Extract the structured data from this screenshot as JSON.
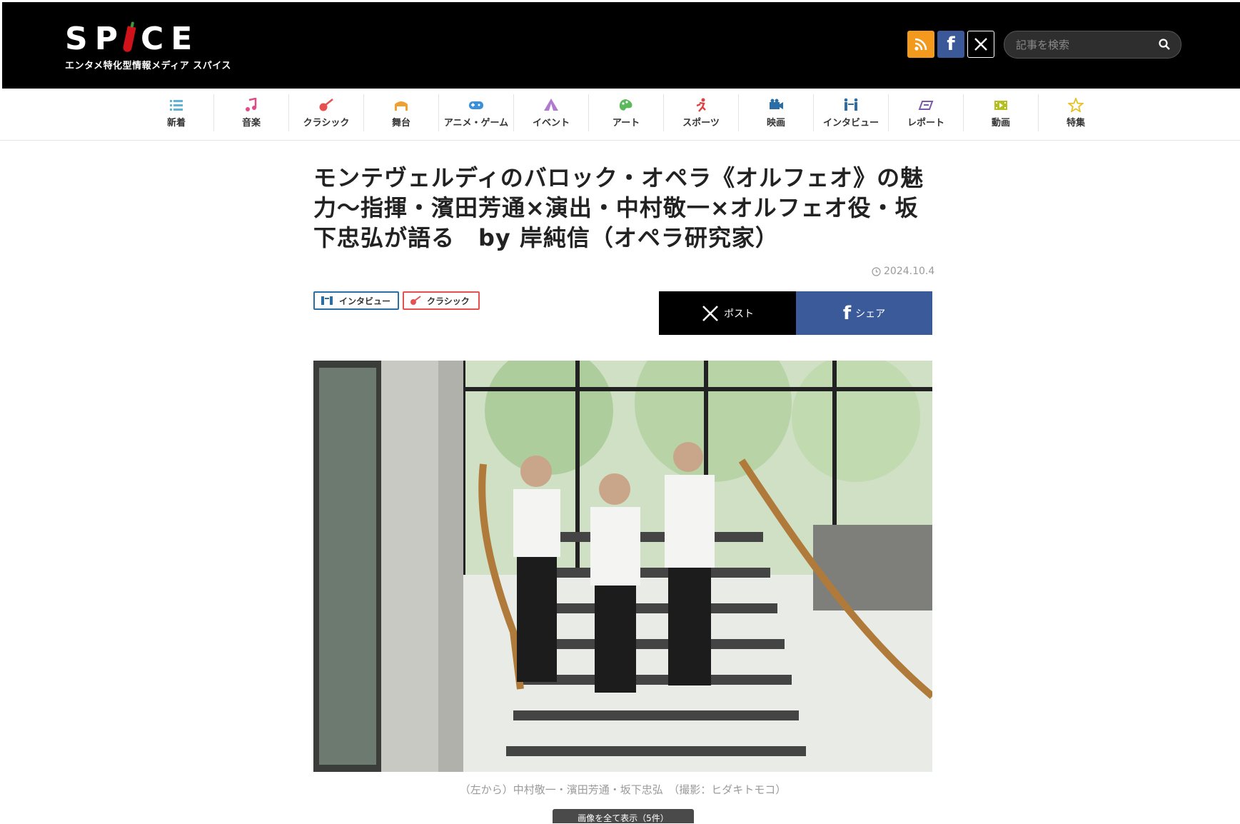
{
  "site": {
    "logo_text": "SP CE",
    "tagline": "エンタメ特化型情報メディア スパイス"
  },
  "header": {
    "search_placeholder": "記事を検索"
  },
  "nav": [
    {
      "label": "新着",
      "icon": "list-icon",
      "color": "#5fb3d9"
    },
    {
      "label": "音楽",
      "icon": "music-note-icon",
      "color": "#e24a8a"
    },
    {
      "label": "クラシック",
      "icon": "guitar-icon",
      "color": "#e65050"
    },
    {
      "label": "舞台",
      "icon": "stage-icon",
      "color": "#f0a030"
    },
    {
      "label": "アニメ・ゲーム",
      "icon": "gamepad-icon",
      "color": "#3a90d9"
    },
    {
      "label": "イベント",
      "icon": "tent-icon",
      "color": "#b07ad0"
    },
    {
      "label": "アート",
      "icon": "palette-icon",
      "color": "#5cb85c"
    },
    {
      "label": "スポーツ",
      "icon": "runner-icon",
      "color": "#e04040"
    },
    {
      "label": "映画",
      "icon": "camera-icon",
      "color": "#2a6ea5"
    },
    {
      "label": "インタビュー",
      "icon": "interview-icon",
      "color": "#2a6ea5"
    },
    {
      "label": "レポート",
      "icon": "report-icon",
      "color": "#7a5aa8"
    },
    {
      "label": "動画",
      "icon": "film-icon",
      "color": "#b5c020"
    },
    {
      "label": "特集",
      "icon": "star-icon",
      "color": "#e8c020"
    }
  ],
  "article": {
    "title": "モンテヴェルディのバロック・オペラ《オルフェオ》の魅力〜指揮・濱田芳通×演出・中村敬一×オルフェオ役・坂下忠弘が語る　by 岸純信（オペラ研究家）",
    "date": "2024.10.4",
    "tags": [
      "インタビュー",
      "クラシック"
    ],
    "share_x": "ポスト",
    "share_fb": "シェア",
    "caption": "（左から）中村敬一・濱田芳通・坂下忠弘　（撮影：ヒダキトモコ）",
    "show_all": "画像を全て表示（5件）"
  }
}
